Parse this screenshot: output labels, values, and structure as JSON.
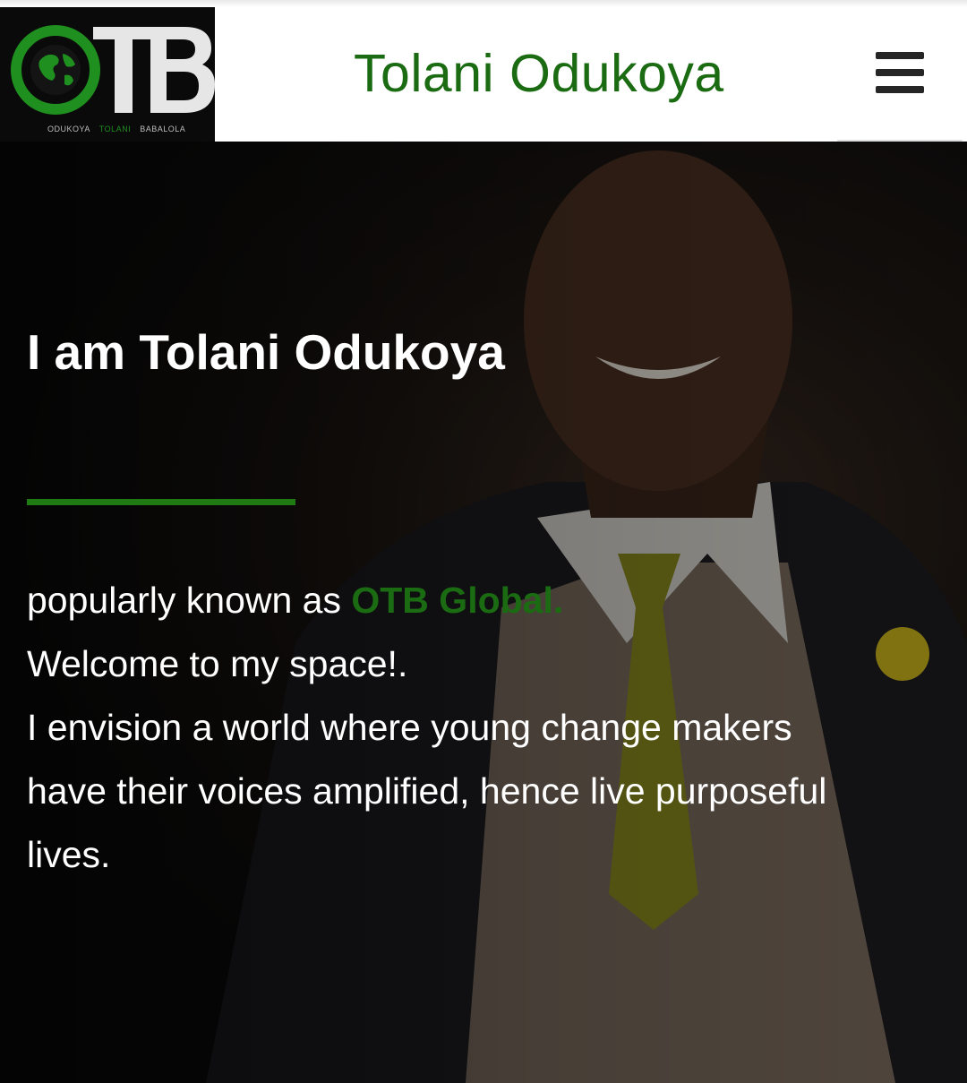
{
  "header": {
    "logo": {
      "letters": "OTB",
      "sub_left": "ODUKOYA",
      "sub_mid": "TOLANI",
      "sub_right": "BABALOLA"
    },
    "site_title": "Tolani Odukoya",
    "menu_icon": "hamburger-menu-icon"
  },
  "hero": {
    "heading": "I am Tolani Odukoya",
    "intro_prefix": "popularly known as ",
    "intro_brand": "OTB Global.",
    "line_welcome": "Welcome to my space!.",
    "line_vision": "I envision a world where young change makers have their voices amplified, hence live purposeful lives."
  },
  "colors": {
    "brand_green": "#1a6b12",
    "divider_green": "#1f7a14",
    "text_white": "#ffffff"
  }
}
